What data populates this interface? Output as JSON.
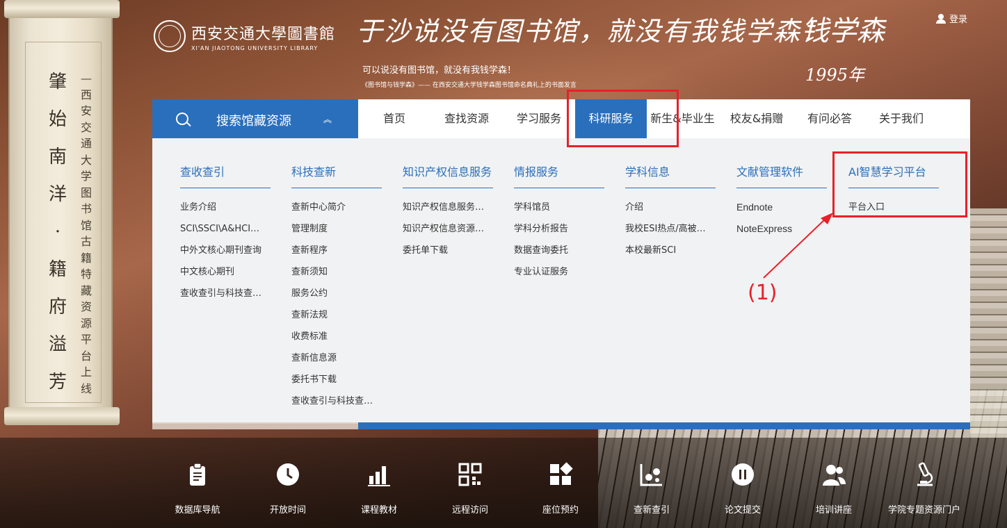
{
  "header": {
    "logo_cn": "西安交通大學圖書館",
    "logo_en": "XI'AN JIAOTONG UNIVERSITY LIBRARY",
    "calligraphy": "于沙说没有图书馆，就没有我钱学森！",
    "calligraphy_sign": "钱学森",
    "calligraphy_year": "1995年",
    "quote_line1": "可以说没有图书馆，就没有我钱学森！",
    "quote_line2": "《图书馆与钱学森》——  在西安交通大学钱学森图书馆命名典礼上的书面发言",
    "login": "登录"
  },
  "scroll": {
    "main_chars": [
      "肇",
      "始",
      "南",
      "洋",
      "·",
      "籍",
      "府",
      "溢",
      "芳"
    ],
    "sub_chars": [
      "—",
      "西",
      "安",
      "交",
      "通",
      "大",
      "学",
      "图",
      "书",
      "馆",
      "古",
      "籍",
      "特",
      "藏",
      "资",
      "源",
      "平",
      "台",
      "上",
      "线"
    ]
  },
  "nav": {
    "search_label": "搜索馆藏资源",
    "items": [
      {
        "label": "首页"
      },
      {
        "label": "查找资源"
      },
      {
        "label": "学习服务"
      },
      {
        "label": "科研服务"
      },
      {
        "label": "新生&毕业生"
      },
      {
        "label": "校友&捐赠"
      },
      {
        "label": "有问必答"
      },
      {
        "label": "关于我们"
      }
    ]
  },
  "menu": {
    "columns": [
      {
        "title": "查收查引",
        "items": [
          "业务介绍",
          "SCI\\SSCI\\A&HCI…",
          "中外文核心期刊查询",
          "中文核心期刊",
          "查收查引与科技查…"
        ]
      },
      {
        "title": "科技查新",
        "items": [
          "查新中心简介",
          "管理制度",
          "查新程序",
          "查新须知",
          "服务公约",
          "查新法规",
          "收费标准",
          "查新信息源",
          "委托书下载",
          "查收查引与科技查…"
        ]
      },
      {
        "title": "知识产权信息服务",
        "items": [
          "知识产权信息服务…",
          "知识产权信息资源…",
          "委托单下载"
        ]
      },
      {
        "title": "情报服务",
        "items": [
          "学科馆员",
          "学科分析报告",
          "数据查询委托",
          "专业认证服务"
        ]
      },
      {
        "title": "学科信息",
        "items": [
          "介绍",
          "我校ESI热点/高被…",
          "本校最新SCI"
        ]
      },
      {
        "title": "文献管理软件",
        "items": [
          "Endnote",
          "NoteExpress"
        ]
      },
      {
        "title": "AI智慧学习平台",
        "items": [
          "平台入口"
        ]
      }
    ]
  },
  "annotation": {
    "label": "(1)",
    "color": "#e8202a"
  },
  "quick_links": [
    {
      "label": "数据库导航",
      "icon": "clipboard-icon"
    },
    {
      "label": "开放时间",
      "icon": "clock-icon"
    },
    {
      "label": "课程教材",
      "icon": "bar-chart-icon"
    },
    {
      "label": "远程访问",
      "icon": "qr-code-icon"
    },
    {
      "label": "座位预约",
      "icon": "grid-icon"
    },
    {
      "label": "查新查引",
      "icon": "scatter-icon"
    },
    {
      "label": "论文提交",
      "icon": "pause-circle-icon"
    },
    {
      "label": "培训讲座",
      "icon": "users-icon"
    },
    {
      "label": "学院专题资源门户",
      "icon": "microscope-icon"
    }
  ],
  "colors": {
    "primary": "#2a6fbc",
    "annotation_red": "#e8202a",
    "menu_bg": "#f1f2f3"
  }
}
